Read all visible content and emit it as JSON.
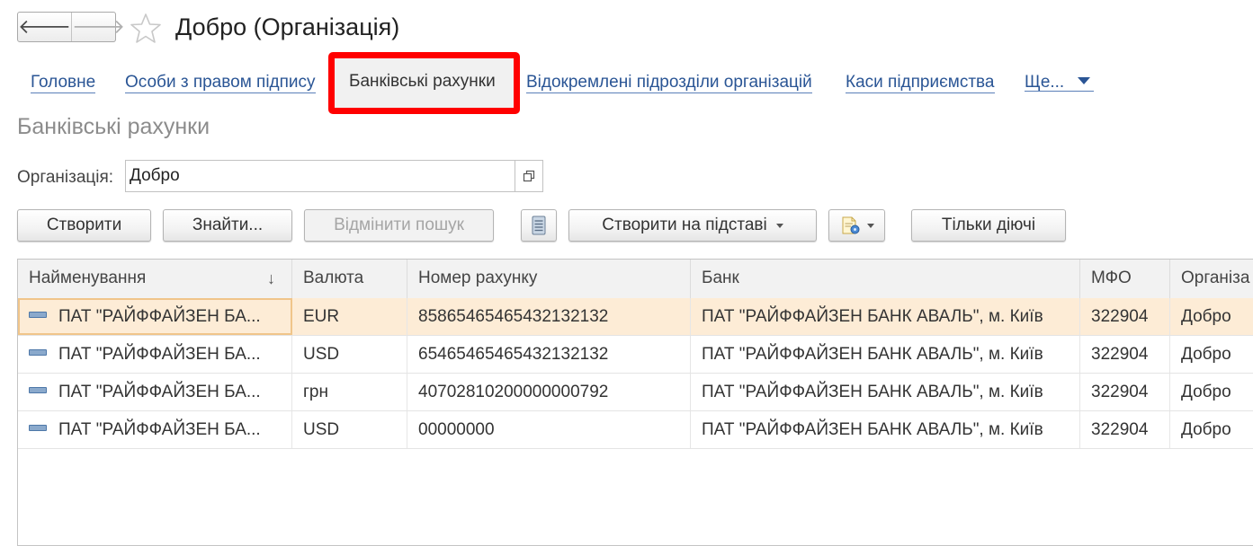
{
  "header": {
    "title": "Добро (Організація)",
    "back_symbol": "🡐",
    "forward_symbol": "🡒"
  },
  "tabs": [
    {
      "label": "Головне"
    },
    {
      "label": "Особи з правом підпису"
    },
    {
      "label": "Банківські рахунки",
      "active": true
    },
    {
      "label": "Відокремлені підрозділи організацій"
    },
    {
      "label": "Каси підприємства"
    },
    {
      "label": "Ще..."
    }
  ],
  "section": {
    "title": "Банківські рахунки"
  },
  "filter": {
    "org_label": "Організація:",
    "org_value": "Добро"
  },
  "toolbar": {
    "create": "Створити",
    "find": "Знайти...",
    "cancel_search": "Відмінити пошук",
    "create_based": "Створити на підставі",
    "only_active": "Тільки діючі"
  },
  "table": {
    "columns": [
      "Найменування",
      "Валюта",
      "Номер рахунку",
      "Банк",
      "МФО",
      "Організа"
    ],
    "sort_indicator": "↓",
    "rows": [
      [
        "ПАТ \"РАЙФФАЙЗЕН БА...",
        "EUR",
        "85865465465432132132",
        "ПАТ \"РАЙФФАЙЗЕН БАНК АВАЛЬ\", м. Київ",
        "322904",
        "Добро"
      ],
      [
        "ПАТ \"РАЙФФАЙЗЕН БА...",
        "USD",
        "65465465465432132132",
        "ПАТ \"РАЙФФАЙЗЕН БАНК АВАЛЬ\", м. Київ",
        "322904",
        "Добро"
      ],
      [
        "ПАТ \"РАЙФФАЙЗЕН БА...",
        "грн",
        "40702810200000000792",
        "ПАТ \"РАЙФФАЙЗЕН БАНК АВАЛЬ\", м. Київ",
        "322904",
        "Добро"
      ],
      [
        "ПАТ \"РАЙФФАЙЗЕН БА...",
        "USD",
        "00000000",
        "ПАТ \"РАЙФФАЙЗЕН БАНК АВАЛЬ\", м. Київ",
        "322904",
        "Добро"
      ]
    ]
  },
  "colors": {
    "link": "#2a5595",
    "highlight_border": "#ff0000",
    "selected_row": "#fdecd6"
  }
}
